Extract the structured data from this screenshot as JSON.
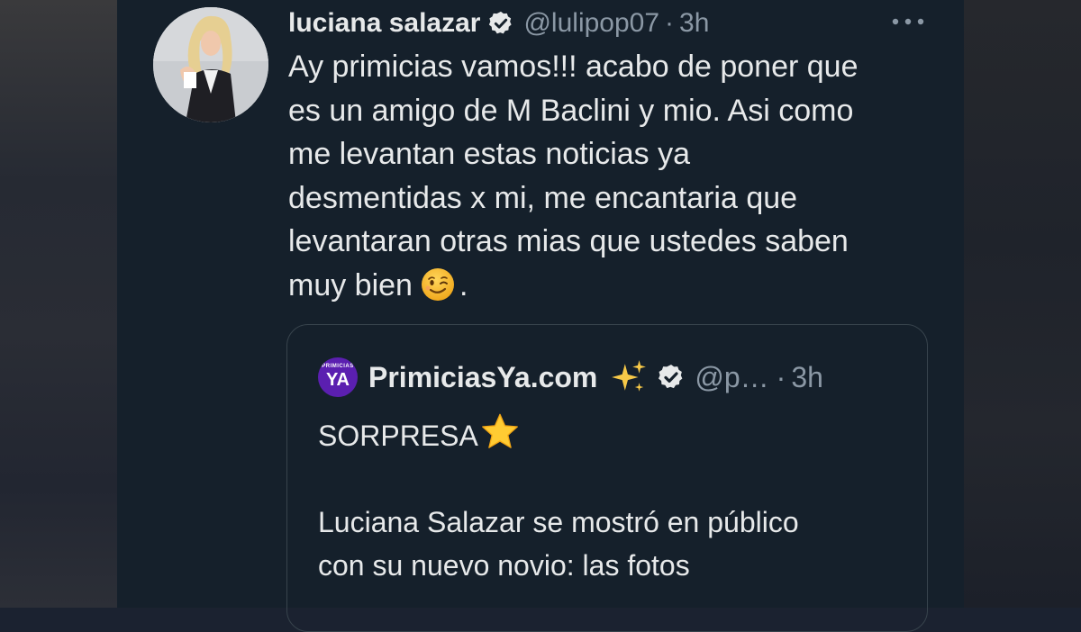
{
  "tweet": {
    "author_name": "luciana salazar",
    "handle": "@lulipop07",
    "separator": "·",
    "time": "3h",
    "more_icon": "more-options-icon",
    "text_lines": [
      "Ay primicias vamos!!! acabo de poner que",
      "es un amigo  de M Baclini y mio. Asi como",
      "me levantan estas noticias ya",
      "desmentidas x mi, me encantaria que",
      "levantaran otras mias que ustedes saben",
      "muy bien"
    ],
    "text_end": ".",
    "emoji": "winking-face-emoji"
  },
  "quoted": {
    "logo_small": "PRIMICIAS",
    "logo_big": "YA",
    "author_name": "PrimiciasYa.com",
    "handle": "@p…",
    "separator": "·",
    "time": "3h",
    "line1": "SORPRESA",
    "line2": "Luciana Salazar se mostró en público",
    "line3": "con su nuevo novio: las fotos"
  },
  "colors": {
    "background": "#15202b",
    "text": "#e7e9ea",
    "muted": "#8b98a5",
    "border": "#38444d",
    "logo": "#5b1fb0"
  }
}
